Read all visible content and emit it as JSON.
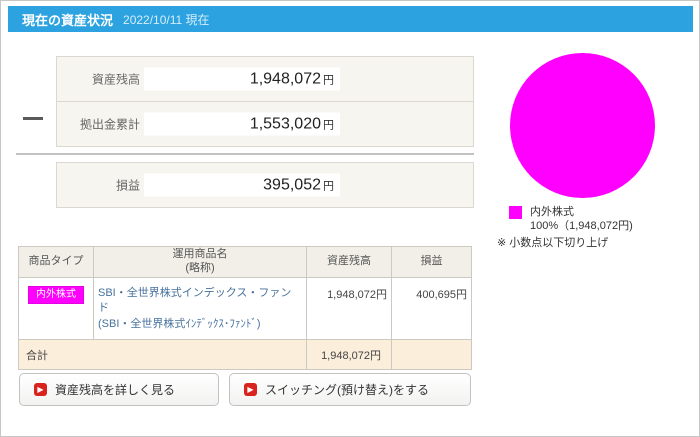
{
  "header": {
    "title": "現在の資産状況",
    "date": "2022/10/11 現在"
  },
  "summary": {
    "rows": [
      {
        "label": "資産残高",
        "value": "1,948,072",
        "unit": "円"
      },
      {
        "label": "拠出金累計",
        "value": "1,553,020",
        "unit": "円"
      }
    ],
    "result": {
      "label": "損益",
      "value": "395,052",
      "unit": "円"
    }
  },
  "table": {
    "headers": {
      "type": "商品タイプ",
      "name_line1": "運用商品名",
      "name_line2": "(略称)",
      "balance": "資産残高",
      "pl": "損益"
    },
    "rows": [
      {
        "type_badge": "内外株式",
        "name_line1": "SBI・全世界株式インデックス・ファンド",
        "name_line2": "(SBI・全世界株式ｲﾝﾃﾞｯｸｽ･ﾌｧﾝﾄﾞ)",
        "balance": "1,948,072円",
        "pl": "400,695円"
      }
    ],
    "total": {
      "label": "合計",
      "balance": "1,948,072円",
      "pl": ""
    }
  },
  "buttons": [
    {
      "label": "資産残高を詳しく見る"
    },
    {
      "label": "スイッチング(預け替え)をする"
    }
  ],
  "icons": {
    "play": "▶"
  },
  "chart": {
    "type": "pie",
    "slices": [
      {
        "label": "内外株式",
        "percent": 100,
        "amount": 1948072,
        "color": "#FF00FF"
      }
    ],
    "legend_line1": "内外株式",
    "legend_line2": "100%（1,948,072円)",
    "note": "※ 小数点以下切り上げ"
  },
  "colors": {
    "header_bar": "#2CA3E0",
    "pie_slice": "#FF00FF",
    "badge": "#FF00FF",
    "total_row_bg": "#fbeedb",
    "button_icon": "#d8231f"
  }
}
